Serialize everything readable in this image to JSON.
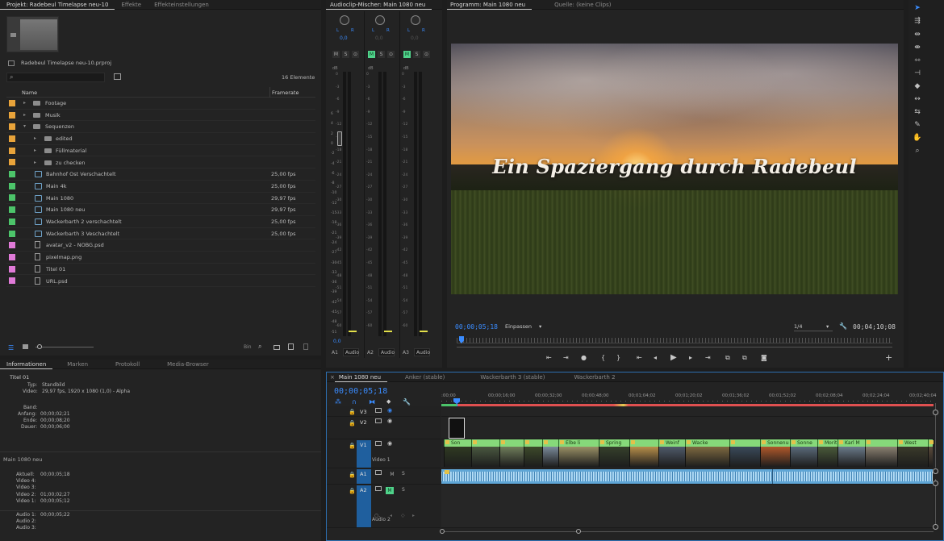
{
  "project_panel": {
    "tabs": [
      "Projekt: Radebeul Timelapse neu-10",
      "Effekte",
      "Effekteinstellungen"
    ],
    "project_file": "Radebeul Timelapse neu-10.prproj",
    "item_count": "16 Elemente",
    "col_name": "Name",
    "col_framerate": "Framerate",
    "items": [
      {
        "name": "Footage",
        "fps": "",
        "color": "#e8a33a",
        "kind": "folder",
        "indent": 0,
        "twirl": "▸"
      },
      {
        "name": "Musik",
        "fps": "",
        "color": "#e8a33a",
        "kind": "folder",
        "indent": 0,
        "twirl": "▸"
      },
      {
        "name": "Sequenzen",
        "fps": "",
        "color": "#e8a33a",
        "kind": "folder",
        "indent": 0,
        "twirl": "▾"
      },
      {
        "name": "edited",
        "fps": "",
        "color": "#e8a33a",
        "kind": "folder",
        "indent": 1,
        "twirl": "▸"
      },
      {
        "name": "Füllmaterial",
        "fps": "",
        "color": "#e8a33a",
        "kind": "folder",
        "indent": 1,
        "twirl": "▸"
      },
      {
        "name": "zu checken",
        "fps": "",
        "color": "#e8a33a",
        "kind": "folder",
        "indent": 1,
        "twirl": "▸"
      },
      {
        "name": "Bahnhof Ost Verschachtelt",
        "fps": "25,00 fps",
        "color": "#4cc46a",
        "kind": "sequence",
        "indent": 1,
        "twirl": ""
      },
      {
        "name": "Main 4k",
        "fps": "25,00 fps",
        "color": "#4cc46a",
        "kind": "sequence",
        "indent": 1,
        "twirl": ""
      },
      {
        "name": "Main 1080",
        "fps": "29,97 fps",
        "color": "#4cc46a",
        "kind": "sequence",
        "indent": 1,
        "twirl": ""
      },
      {
        "name": "Main 1080 neu",
        "fps": "29,97 fps",
        "color": "#4cc46a",
        "kind": "sequence",
        "indent": 1,
        "twirl": ""
      },
      {
        "name": "Wackerbarth 2 verschachtelt",
        "fps": "25,00 fps",
        "color": "#4cc46a",
        "kind": "sequence",
        "indent": 1,
        "twirl": ""
      },
      {
        "name": "Wackerbarth 3 Veschachtelt",
        "fps": "25,00 fps",
        "color": "#4cc46a",
        "kind": "sequence",
        "indent": 1,
        "twirl": ""
      },
      {
        "name": "avatar_v2 - NOBG.psd",
        "fps": "",
        "color": "#e07ad8",
        "kind": "file",
        "indent": 1,
        "twirl": ""
      },
      {
        "name": "pixelmap.png",
        "fps": "",
        "color": "#e07ad8",
        "kind": "file",
        "indent": 1,
        "twirl": ""
      },
      {
        "name": "Titel 01",
        "fps": "",
        "color": "#e07ad8",
        "kind": "file",
        "indent": 1,
        "twirl": ""
      },
      {
        "name": "URL.psd",
        "fps": "",
        "color": "#e07ad8",
        "kind": "file",
        "indent": 1,
        "twirl": ""
      }
    ],
    "bottom_label": "Bin"
  },
  "info_panel": {
    "tabs": [
      "Informationen",
      "Marken",
      "Protokoll",
      "Media-Browser"
    ],
    "title": "Titel 01",
    "lines": [
      {
        "k": "Typ:",
        "v": "Standbild"
      },
      {
        "k": "Video:",
        "v": "29,97 fps, 1920 x 1080 (1,0) - Alpha"
      }
    ],
    "band_label": "Band:",
    "range": [
      {
        "k": "Anfang:",
        "v": "00;00;02;21"
      },
      {
        "k": "Ende:",
        "v": "00;00;08;20"
      },
      {
        "k": "Dauer:",
        "v": "00;00;06;00"
      }
    ],
    "seq_title": "Main 1080 neu",
    "seq_lines": [
      {
        "k": "Aktuell:",
        "v": "00;00;05;18"
      },
      {
        "k": "Video 4:",
        "v": ""
      },
      {
        "k": "Video 3:",
        "v": ""
      },
      {
        "k": "Video 2:",
        "v": "01;00;02;27"
      },
      {
        "k": "Video 1:",
        "v": "00;00;05;12"
      }
    ],
    "audio_lines": [
      {
        "k": "Audio 1:",
        "v": "00;00;05;22"
      },
      {
        "k": "Audio 2:",
        "v": ""
      },
      {
        "k": "Audio 3:",
        "v": ""
      }
    ]
  },
  "mixer": {
    "tab": "Audioclip-Mischer: Main 1080 neu",
    "lr_label": "L",
    "lr_right": "R",
    "channels": [
      {
        "value": "0,0",
        "track": "A1",
        "name": "Audio",
        "m_on": false
      },
      {
        "value": "0,0",
        "track": "A2",
        "name": "Audio",
        "m_on": true
      },
      {
        "value": "0,0",
        "track": "A3",
        "name": "Audio",
        "m_on": true
      }
    ],
    "db_label": "dB",
    "db_scale": [
      "0",
      "-3",
      "-6",
      "-9",
      "-12",
      "-15",
      "-18",
      "-21",
      "-24",
      "-27",
      "-30",
      "-33",
      "-36",
      "-39",
      "-42",
      "-45",
      "-48",
      "-51",
      "-54",
      "-57",
      "-60"
    ],
    "fader_scale": [
      "6",
      "4",
      "2",
      "0",
      "-2",
      "-4",
      "-6",
      "-8",
      "-10",
      "-12",
      "-15",
      "-18",
      "-21",
      "-24",
      "-27",
      "-30",
      "-33",
      "-36",
      "-39",
      "-42",
      "-45",
      "-48",
      "-51"
    ],
    "fader_value": "0,0"
  },
  "program_monitor": {
    "tabs": [
      "Programm: Main 1080 neu",
      "Quelle: (keine Clips)"
    ],
    "title_overlay": "Ein Spaziergang durch Radebeul",
    "timecode": "00;00;05;18",
    "fit": "Einpassen",
    "resolution": "1/4",
    "duration": "00;04;10;08"
  },
  "timeline": {
    "tabs": [
      "Main 1080 neu",
      "Anker (stable)",
      "Wackerbarth 3 (stable)",
      "Wackerbarth 2"
    ],
    "timecode": "00;00;05;18",
    "ruler": [
      ":00;00",
      "00;00;16;00",
      "00;00;32;00",
      "00;00;48;00",
      "00;01;04;02",
      "00;01;20;02",
      "00;01;36;02",
      "00;01;52;02",
      "00;02;08;04",
      "00;02;24;04",
      "00;02;40;04"
    ],
    "tracks": [
      {
        "id": "V3",
        "label": ""
      },
      {
        "id": "V2",
        "label": ""
      },
      {
        "id": "V1",
        "label": "Video 1"
      },
      {
        "id": "A1",
        "label": ""
      },
      {
        "id": "A2",
        "label": "Audio 2"
      }
    ],
    "clips": [
      "Son",
      "Elbe li",
      "Spring",
      "Weinf",
      "Wacke",
      "Sonnenunte",
      "Sonne",
      "Moritz",
      "Karl M",
      "West"
    ],
    "m_label": "M",
    "s_label": "S"
  },
  "colors": {
    "accent": "#2d8ceb",
    "clip_green": "#86d97a",
    "audio_wave": "#7fb9e0",
    "playhead": "#3a8cff"
  }
}
